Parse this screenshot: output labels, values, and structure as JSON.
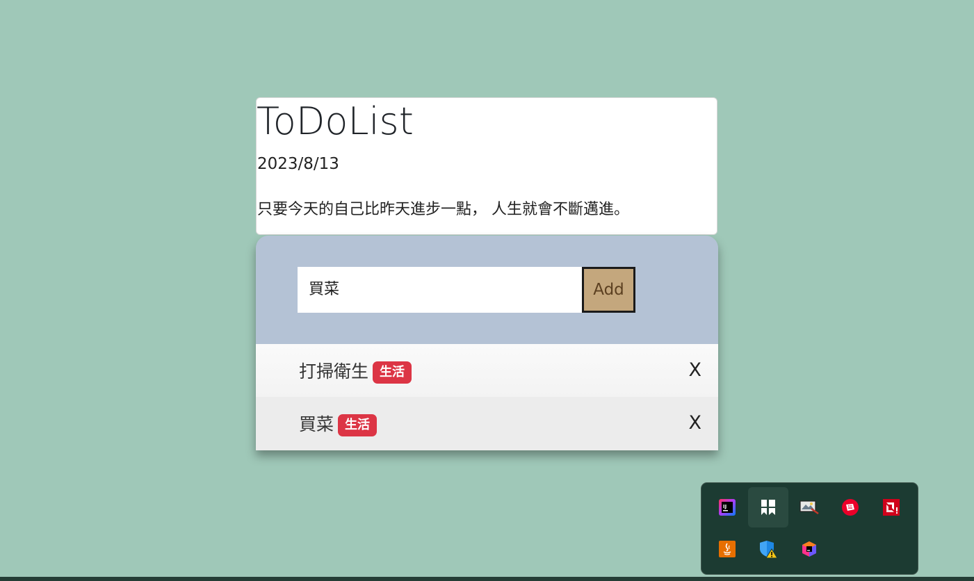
{
  "header": {
    "title": "ToDoList",
    "date": "2023/8/13",
    "quote": "只要今天的自己比昨天進步一點， 人生就會不斷邁進。"
  },
  "form": {
    "input_value": "買菜",
    "add_label": "Add"
  },
  "todos": [
    {
      "text": "打掃衛生",
      "tag": "生活",
      "delete_label": "X"
    },
    {
      "text": "買菜",
      "tag": "生活",
      "delete_label": "X"
    }
  ],
  "colors": {
    "background": "#9fc8b8",
    "input_zone": "#b4c2d5",
    "add_button": "#c4a77d",
    "badge": "#dc3545",
    "tray": "#1c3b32"
  },
  "tray_icons": [
    "intellij-idea-icon",
    "window-manager-icon",
    "image-tool-icon",
    "riot-client-icon",
    "amd-software-icon",
    "java-icon",
    "windows-security-warning-icon",
    "jetbrains-toolbox-icon"
  ]
}
